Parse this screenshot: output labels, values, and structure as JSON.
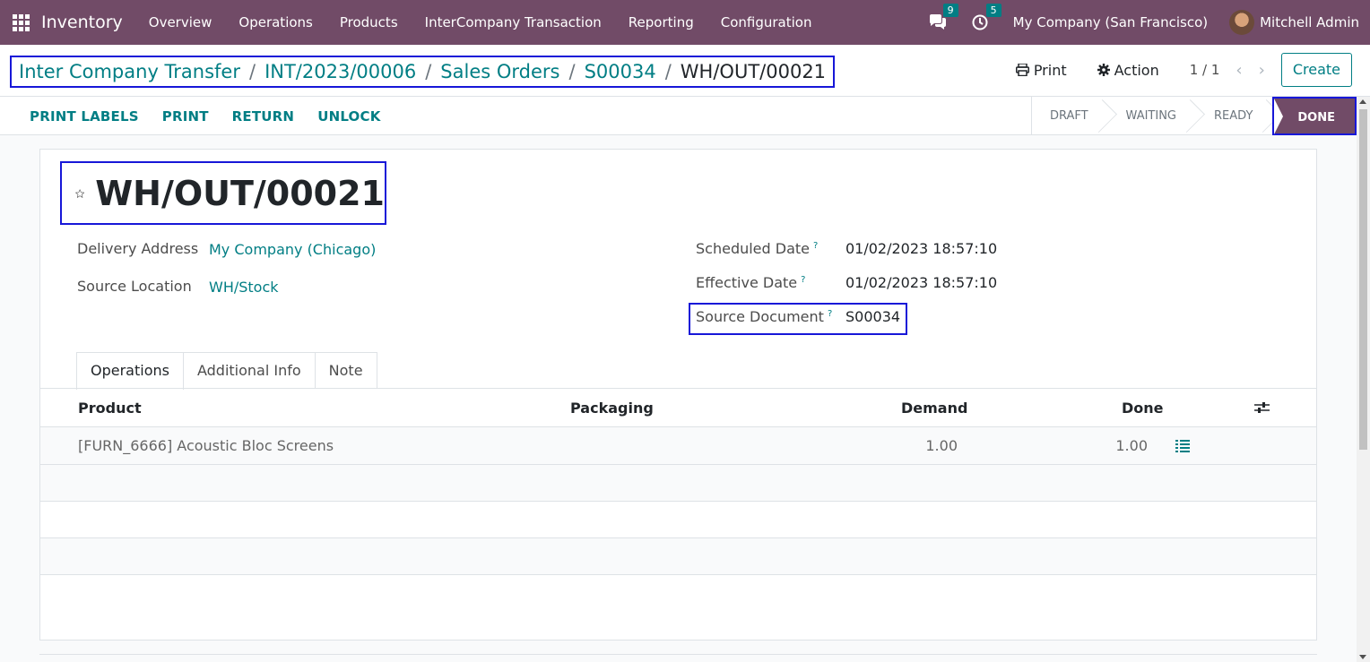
{
  "navbar": {
    "app_name": "Inventory",
    "menu": [
      "Overview",
      "Operations",
      "Products",
      "InterCompany Transaction",
      "Reporting",
      "Configuration"
    ],
    "messages_count": "9",
    "activities_count": "5",
    "company": "My Company (San Francisco)",
    "user": "Mitchell Admin"
  },
  "breadcrumb": {
    "items": [
      "Inter Company Transfer",
      "INT/2023/00006",
      "Sales Orders",
      "S00034"
    ],
    "current": "WH/OUT/00021",
    "separator": "/"
  },
  "control": {
    "print_label": "Print",
    "action_label": "Action",
    "pager": "1 / 1",
    "create_label": "Create"
  },
  "statusbar": {
    "buttons": [
      "PRINT LABELS",
      "PRINT",
      "RETURN",
      "UNLOCK"
    ],
    "stages": [
      "DRAFT",
      "WAITING",
      "READY",
      "DONE"
    ],
    "current_stage": "DONE"
  },
  "record": {
    "title": "WH/OUT/00021",
    "delivery_address_label": "Delivery Address",
    "delivery_address": "My Company (Chicago)",
    "source_location_label": "Source Location",
    "source_location": "WH/Stock",
    "scheduled_date_label": "Scheduled Date",
    "scheduled_date": "01/02/2023 18:57:10",
    "effective_date_label": "Effective Date",
    "effective_date": "01/02/2023 18:57:10",
    "source_document_label": "Source Document",
    "source_document": "S00034",
    "help_marker": "?"
  },
  "tabs": [
    "Operations",
    "Additional Info",
    "Note"
  ],
  "table": {
    "headers": {
      "product": "Product",
      "packaging": "Packaging",
      "demand": "Demand",
      "done": "Done"
    },
    "rows": [
      {
        "product": "[FURN_6666] Acoustic Bloc Screens",
        "packaging": "",
        "demand": "1.00",
        "done": "1.00"
      }
    ]
  },
  "colors": {
    "brand": "#714b67",
    "accent": "#017e84",
    "highlight_box": "#1717d8"
  }
}
